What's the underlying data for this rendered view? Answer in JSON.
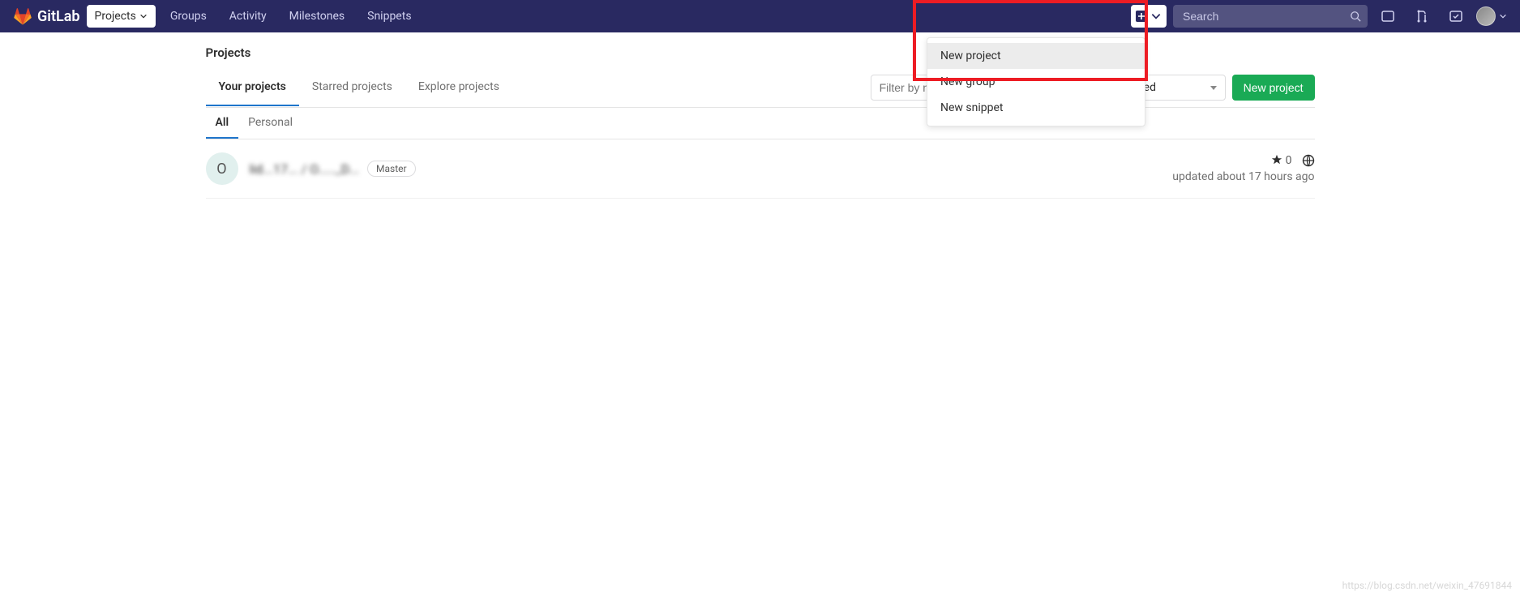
{
  "brand": "GitLab",
  "nav": {
    "projects": "Projects",
    "groups": "Groups",
    "activity": "Activity",
    "milestones": "Milestones",
    "snippets": "Snippets"
  },
  "search": {
    "placeholder": "Search"
  },
  "plus_dropdown": {
    "items": [
      "New project",
      "New group",
      "New snippet"
    ]
  },
  "page": {
    "title": "Projects",
    "tabs": {
      "your": "Your projects",
      "starred": "Starred projects",
      "explore": "Explore projects"
    },
    "filter_placeholder": "Filter by name...",
    "sort_label": "Last updated",
    "new_project_btn": "New project",
    "subtabs": {
      "all": "All",
      "personal": "Personal"
    }
  },
  "project": {
    "initial": "O",
    "name": "lid...17... / O....._D...",
    "role_badge": "Master",
    "stars": "0",
    "updated": "updated about 17 hours ago"
  },
  "watermark": "https://blog.csdn.net/weixin_47691844"
}
